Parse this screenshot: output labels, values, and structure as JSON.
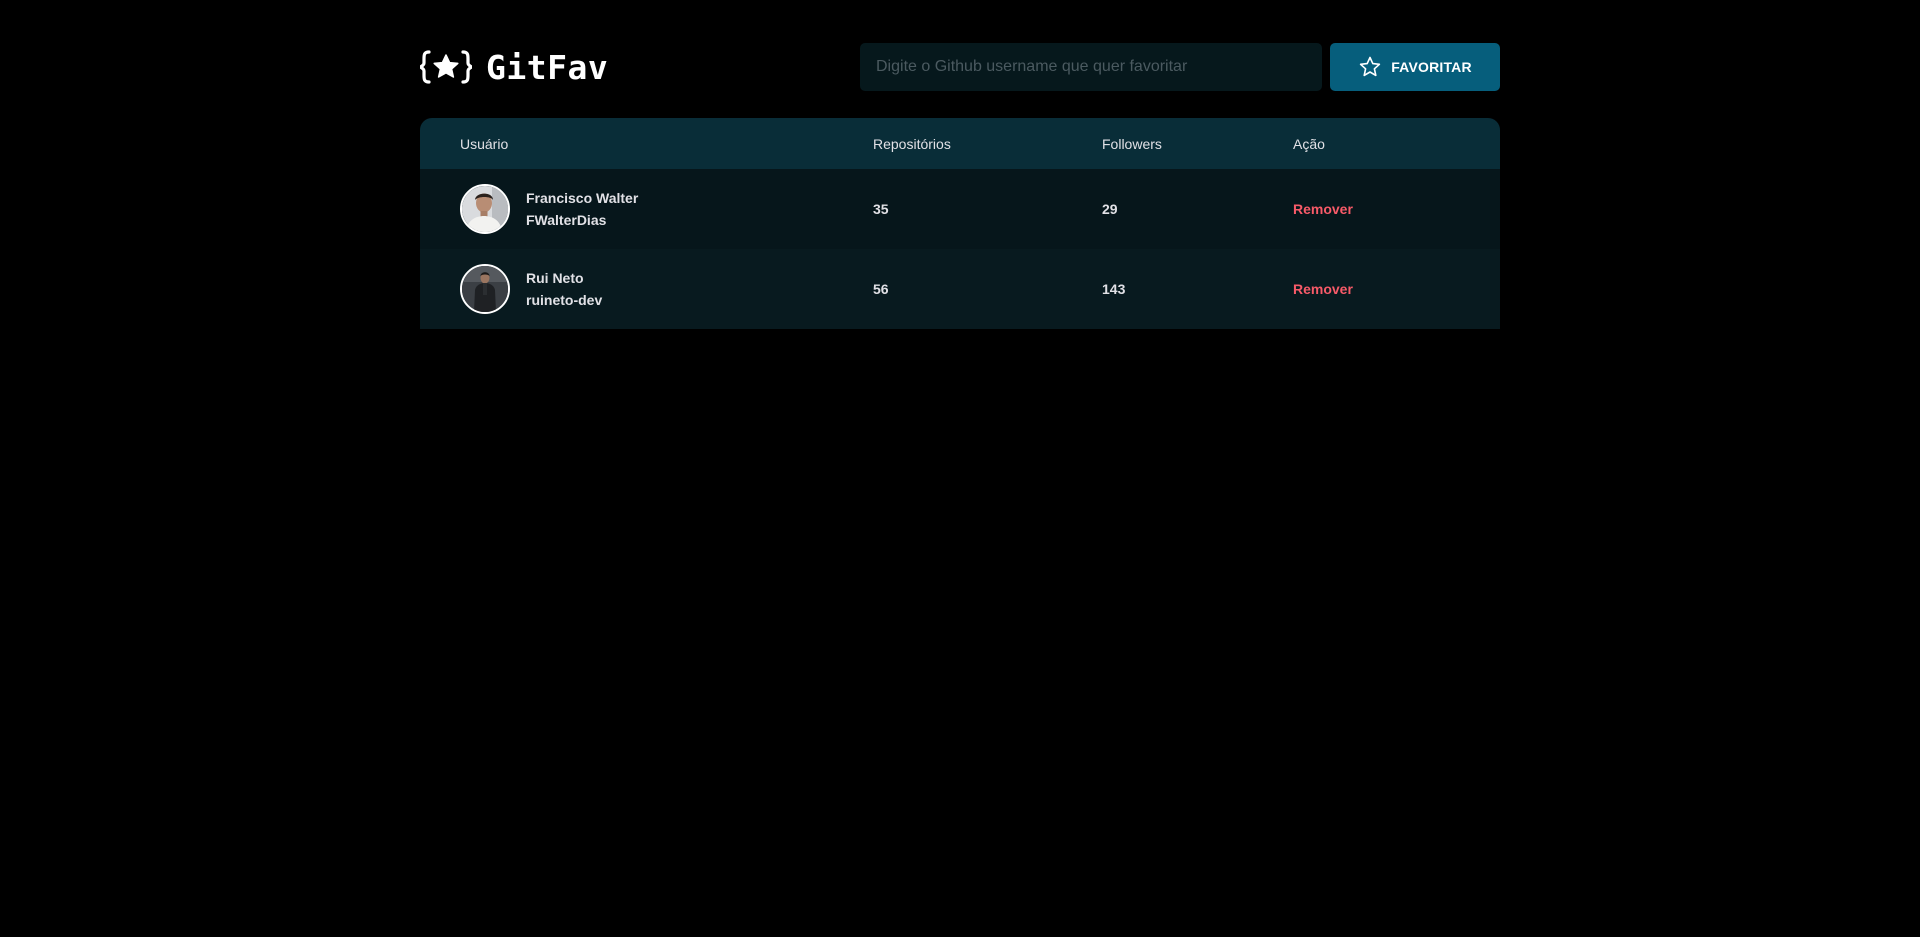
{
  "header": {
    "logo_text": "GitFav",
    "logo_icon": "braces-star-icon"
  },
  "search": {
    "placeholder": "Digite o Github username que quer favoritar",
    "value": "",
    "button_label": "FAVORITAR",
    "button_icon": "star-outline-icon"
  },
  "table": {
    "columns": {
      "user": "Usuário",
      "repos": "Repositórios",
      "followers": "Followers",
      "action": "Ação"
    },
    "rows": [
      {
        "name": "Francisco Walter",
        "login": "FWalterDias",
        "repositories": "35",
        "followers": "29",
        "action_label": "Remover"
      },
      {
        "name": "Rui Neto",
        "login": "ruineto-dev",
        "repositories": "56",
        "followers": "143",
        "action_label": "Remover"
      }
    ]
  },
  "colors": {
    "background": "#000000",
    "header_row": "#092D38",
    "row_odd": "#06161B",
    "row_even": "#081A1F",
    "button": "#065E7C",
    "input": "#06181C",
    "remove": "#F75A68",
    "text": "#E1E1E6"
  }
}
